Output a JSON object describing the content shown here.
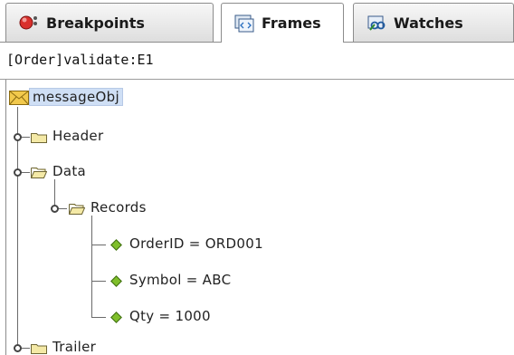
{
  "tabs": [
    {
      "label": "Breakpoints",
      "icon": "breakpoints-icon",
      "active": false
    },
    {
      "label": "Frames",
      "icon": "frames-icon",
      "active": true
    },
    {
      "label": "Watches",
      "icon": "watches-icon",
      "active": false
    }
  ],
  "context": {
    "frame": "[Order]validate:E1"
  },
  "tree": {
    "root": {
      "label": "messageObj",
      "icon": "envelope-icon"
    },
    "nodes": [
      {
        "label": "Header",
        "icon": "folder-closed-icon"
      },
      {
        "label": "Data",
        "icon": "folder-open-icon"
      },
      {
        "label": "Records",
        "icon": "folder-open-icon"
      },
      {
        "label": "OrderID = ORD001",
        "icon": "field-diamond-icon"
      },
      {
        "label": "Symbol = ABC",
        "icon": "field-diamond-icon"
      },
      {
        "label": "Qty = 1000",
        "icon": "field-diamond-icon"
      },
      {
        "label": "Trailer",
        "icon": "folder-closed-icon"
      }
    ]
  },
  "colors": {
    "selection": "#cfdff5",
    "field_diamond": "#7fbf2a",
    "folder": "#f4e9a6",
    "envelope": "#f2c94c",
    "breakpoint_red": "#d9302c"
  }
}
